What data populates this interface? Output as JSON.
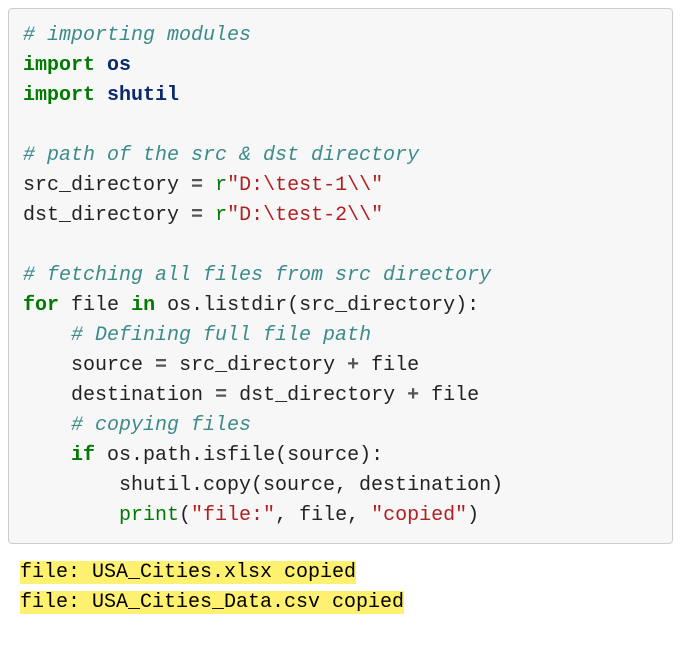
{
  "code": {
    "c1": "# importing modules",
    "k_import1": "import",
    "m_os": "os",
    "k_import2": "import",
    "m_shutil": "shutil",
    "c2": "# path of the src & dst directory",
    "n_src": "src_directory",
    "eq": "=",
    "r": "r",
    "s_src": "\"D:\\test-1\\\\\"",
    "n_dst": "dst_directory",
    "s_dst": "\"D:\\test-2\\\\\"",
    "c3": "# fetching all files from src directory",
    "k_for": "for",
    "n_file": "file",
    "k_in": "in",
    "fn_listdir": "os.listdir(src_directory):",
    "c4": "# Defining full file path",
    "n_source": "source",
    "plus": "+",
    "n_dest": "destination",
    "c5": "# copying files",
    "k_if": "if",
    "fn_isfile": "os.path.isfile(source):",
    "fn_copy": "shutil.copy(source, destination)",
    "fn_print": "print",
    "s_fileprefix": "\"file:\"",
    "comma": ",",
    "s_copied": "\"copied\"",
    "rparen": ")",
    "lparen": "("
  },
  "output": {
    "line1": "file: USA_Cities.xlsx copied",
    "line2": "file: USA_Cities_Data.csv copied"
  }
}
